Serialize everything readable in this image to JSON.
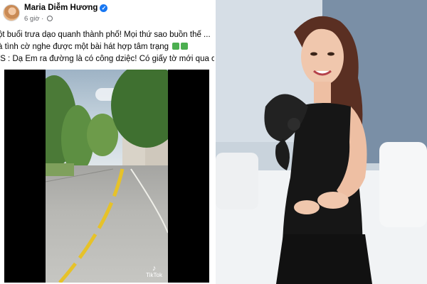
{
  "post": {
    "author": "Maria Diễm Hương",
    "time": "6 giờ",
    "line1": "ột buổi trưa dạo quanh thành phố! Mọi thứ sao buồn thế ...",
    "line2": "à tình cờ nghe được một bài hát hợp tâm trạng",
    "line3": "/S : Dạ Em ra đường là có công dziệc! Có giấy tờ mới  qua ch",
    "video_watermark": "TikTok"
  },
  "icons": {
    "verified": "verified-badge-icon",
    "globe": "globe-icon",
    "tiktok": "tiktok-logo-icon",
    "recycle": "recycle-emoji-icon"
  },
  "colors": {
    "facebook_blue": "#1877f2",
    "text": "#050505",
    "muted": "#65676b"
  }
}
